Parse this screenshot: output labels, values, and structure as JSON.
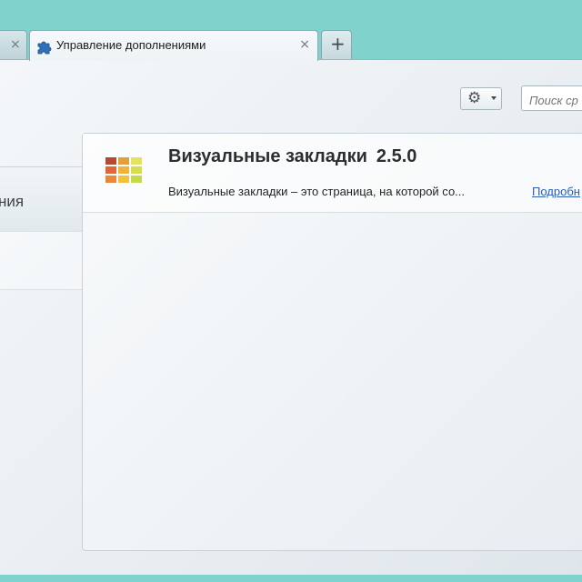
{
  "tabs": {
    "prev_close": "×",
    "active_title": "Управление дополнениями",
    "active_close": "×",
    "new_tab_symbol": "+",
    "active_icon": "puzzle-icon"
  },
  "toolbar": {
    "tools_icon": "gear-icon",
    "search_placeholder": "Поиск ср"
  },
  "sidebar": {
    "active_label": "ния"
  },
  "addon": {
    "icon": "visual-bookmarks-grid-icon",
    "name": "Визуальные закладки",
    "version": "2.5.0",
    "description": "Визуальные закладки – это страница, на которой со...",
    "more_link": "Подробн"
  },
  "colors": {
    "window_frame": "#7fd3cc",
    "link": "#2a5fb8"
  }
}
